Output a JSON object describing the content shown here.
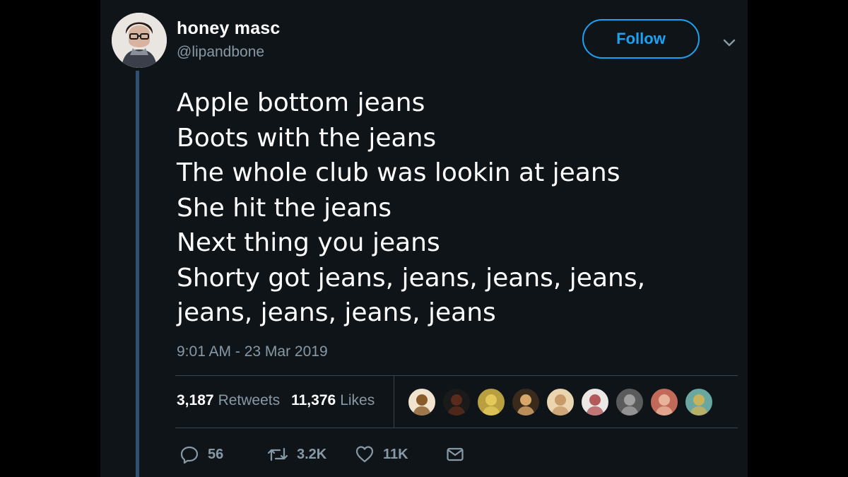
{
  "author": {
    "display_name": "honey masc",
    "handle": "@lipandbone"
  },
  "follow_button": {
    "label": "Follow"
  },
  "tweet": {
    "lines": [
      "Apple bottom jeans",
      "Boots with the jeans",
      "The whole club was lookin at jeans",
      "She hit the jeans",
      "Next thing you jeans",
      "Shorty got jeans, jeans, jeans, jeans,",
      "jeans, jeans, jeans, jeans"
    ],
    "timestamp": "9:01 AM - 23 Mar 2019"
  },
  "stats": {
    "retweets_count": "3,187",
    "retweets_label": "Retweets",
    "likes_count": "11,376",
    "likes_label": "Likes"
  },
  "liker_avatars": [
    {
      "name": "liker-avatar-1",
      "bg": "#f1e4cf",
      "fg": "#8a5a2b"
    },
    {
      "name": "liker-avatar-2",
      "bg": "#1a1a1a",
      "fg": "#5a2a1a"
    },
    {
      "name": "liker-avatar-3",
      "bg": "#b8a040",
      "fg": "#e4c85a"
    },
    {
      "name": "liker-avatar-4",
      "bg": "#3a2a1c",
      "fg": "#d9a76a"
    },
    {
      "name": "liker-avatar-5",
      "bg": "#e9d6b0",
      "fg": "#c89a6a"
    },
    {
      "name": "liker-avatar-6",
      "bg": "#ece8e6",
      "fg": "#b35a5a"
    },
    {
      "name": "liker-avatar-7",
      "bg": "#5b5b5b",
      "fg": "#a0a0a0"
    },
    {
      "name": "liker-avatar-8",
      "bg": "#c26a5a",
      "fg": "#e8b39a"
    },
    {
      "name": "liker-avatar-9",
      "bg": "#6aa7a0",
      "fg": "#c9b35a"
    }
  ],
  "actions": {
    "reply_count": "56",
    "retweet_count": "3.2K",
    "like_count": "11K"
  },
  "colors": {
    "background": "#0f1419",
    "accent": "#1da1f2",
    "muted_text": "#8899a6",
    "divider": "#38444d",
    "thread_line": "#2f4f73"
  }
}
